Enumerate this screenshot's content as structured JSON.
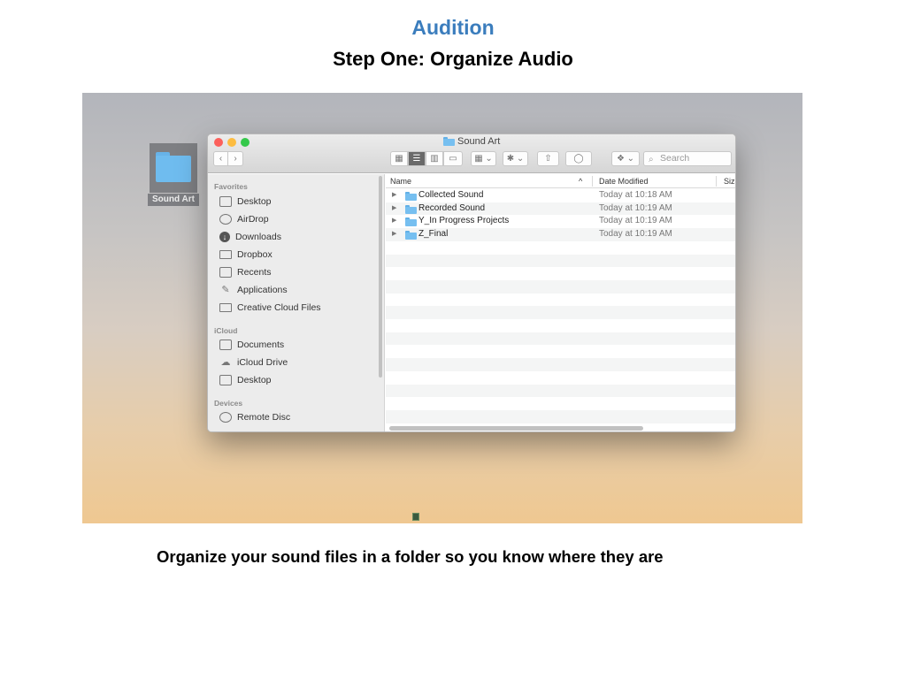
{
  "slide": {
    "title": "Audition",
    "subtitle": "Step One: Organize Audio",
    "caption": "Organize your sound files in a folder so you know where they are"
  },
  "desktop": {
    "folder_label": "Sound Art"
  },
  "finder": {
    "window_title": "Sound Art",
    "search_placeholder": "Search",
    "toolbar": {
      "back": "‹",
      "forward": "›",
      "view_icon": "▦",
      "view_list": "☰",
      "view_column": "▥",
      "view_gallery": "▭",
      "arrange": "▦ ⌄",
      "action": "✱ ⌄",
      "share": "⇧",
      "tag": "◯",
      "dropbox": "❖ ⌄"
    },
    "sidebar": {
      "sections": [
        {
          "title": "Favorites",
          "items": [
            {
              "label": "Desktop",
              "icon": "desktop-icon"
            },
            {
              "label": "AirDrop",
              "icon": "airdrop-icon"
            },
            {
              "label": "Downloads",
              "icon": "downloads-icon"
            },
            {
              "label": "Dropbox",
              "icon": "folder-icon"
            },
            {
              "label": "Recents",
              "icon": "recents-icon"
            },
            {
              "label": "Applications",
              "icon": "applications-icon"
            },
            {
              "label": "Creative Cloud Files",
              "icon": "folder-icon"
            }
          ]
        },
        {
          "title": "iCloud",
          "items": [
            {
              "label": "Documents",
              "icon": "documents-icon"
            },
            {
              "label": "iCloud Drive",
              "icon": "cloud-icon"
            },
            {
              "label": "Desktop",
              "icon": "desktop-icon"
            }
          ]
        },
        {
          "title": "Devices",
          "items": [
            {
              "label": "Remote Disc",
              "icon": "disc-icon"
            }
          ]
        }
      ]
    },
    "columns": {
      "name": "Name",
      "sort_indicator": "^",
      "date_modified": "Date Modified",
      "size": "Siz"
    },
    "files": [
      {
        "name": "Collected Sound",
        "date": "Today at 10:18 AM"
      },
      {
        "name": "Recorded Sound",
        "date": "Today at 10:19 AM"
      },
      {
        "name": "Y_In Progress Projects",
        "date": "Today at 10:19 AM"
      },
      {
        "name": "Z_Final",
        "date": "Today at 10:19 AM"
      }
    ],
    "empty_rows": 14
  }
}
